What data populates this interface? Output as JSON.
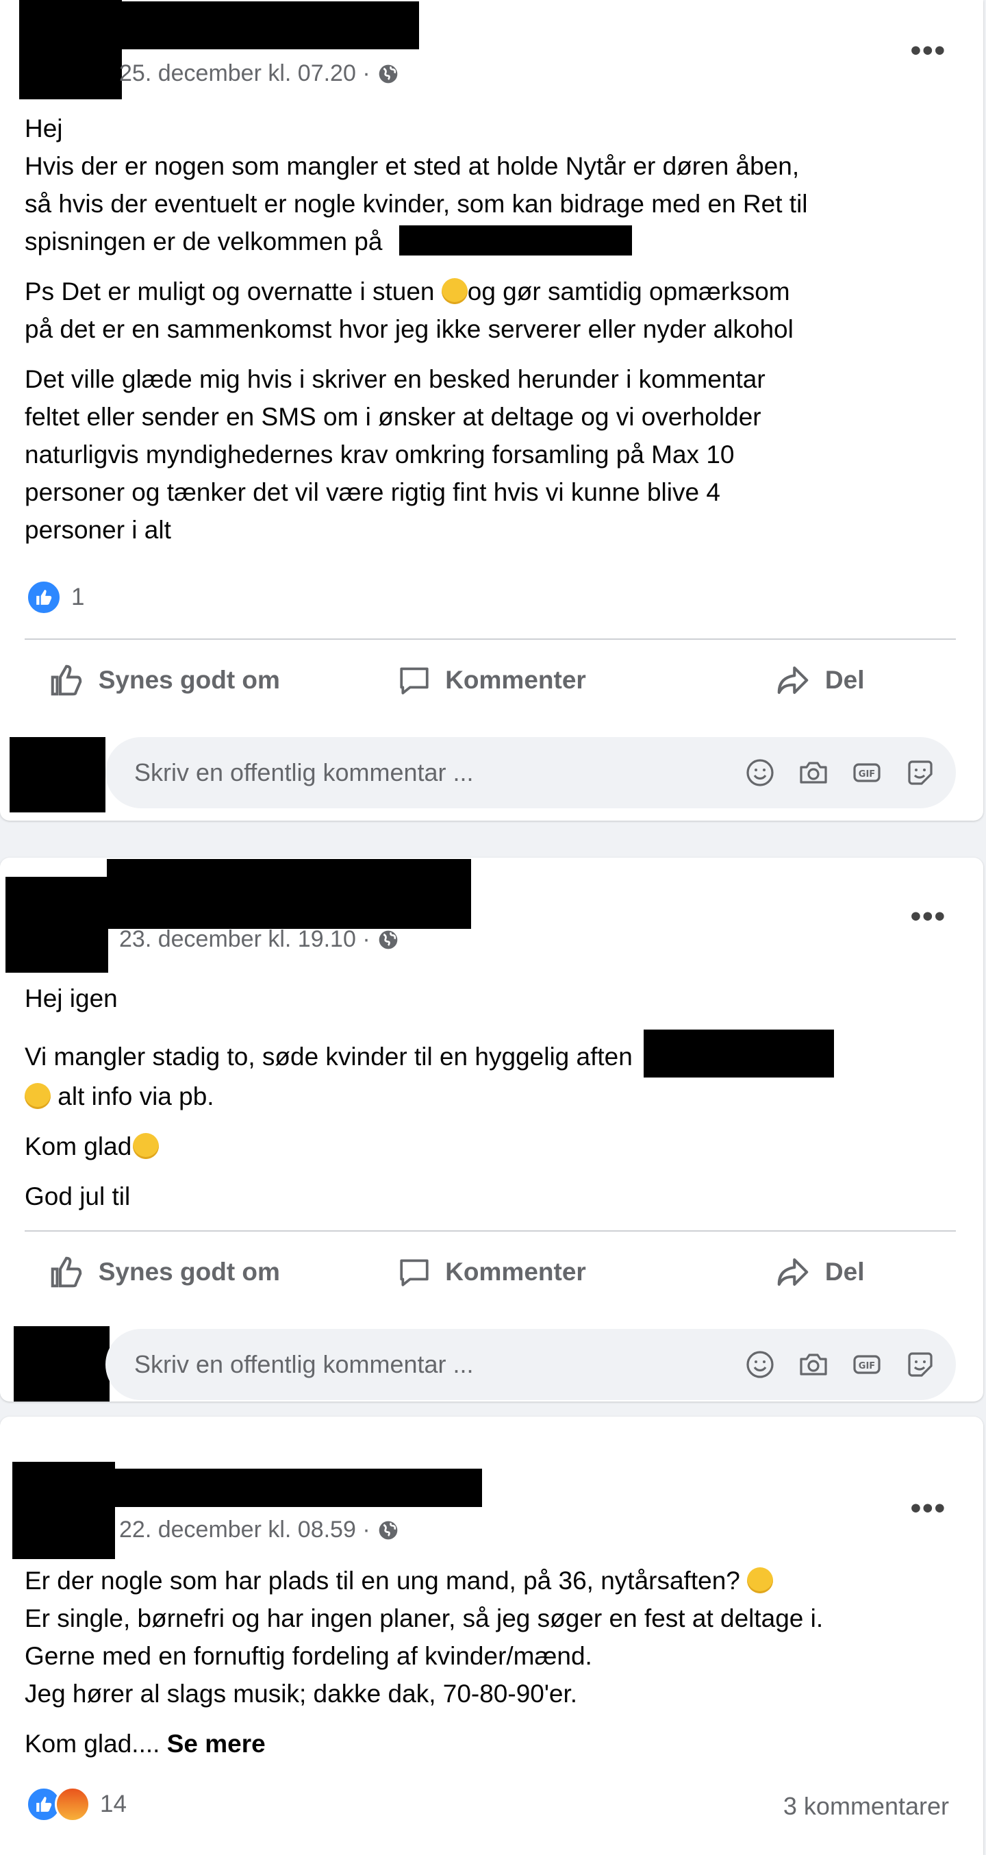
{
  "posts": [
    {
      "timestamp": "25. december kl. 07.20 ·",
      "paragraphs": [
        [
          "Hej",
          "Hvis der er nogen som mangler et sted at holde Nytår er døren åben,",
          "så hvis der eventuelt er nogle kvinder, som kan bidrage med en Ret til",
          "spisningen er de velkommen på"
        ],
        [
          "Ps Det er muligt og overnatte i stuen",
          "og gør samtidig opmærksom",
          "på det er en sammenkomst hvor jeg ikke  serverer eller nyder alkohol"
        ],
        [
          "Det ville glæde mig hvis i skriver en besked herunder i kommentar",
          "feltet eller sender en SMS om i ønsker at deltage og vi overholder",
          "naturligvis myndighedernes krav omkring forsamling på Max 10",
          "personer og tænker det vil være rigtig fint hvis vi kunne blive 4",
          "personer i alt"
        ]
      ],
      "reaction_count": "1"
    },
    {
      "timestamp": "23. december kl. 19.10 ·",
      "lines": [
        "Hej igen",
        "Vi mangler stadig to, søde kvinder til en hyggelig aften",
        "alt info via pb.",
        "Kom glad",
        "God jul til"
      ]
    },
    {
      "timestamp": "22. december kl. 08.59 ·",
      "lines": [
        "Er der nogle som har plads til en ung mand, på 36, nytårsaften?",
        "Er single, børnefri og har ingen planer, så jeg søger en fest at deltage i.",
        "Gerne med en fornuftig fordeling af kvinder/mænd.",
        "Jeg hører al slags musik; dakke dak, 70-80-90'er.",
        "Kom glad....",
        "Se mere"
      ],
      "reaction_count": "14",
      "comments_count": "3 kommentarer"
    }
  ],
  "actions": {
    "like": "Synes godt om",
    "comment": "Kommenter",
    "share": "Del"
  },
  "comment_placeholder": "Skriv en offentlig kommentar ...",
  "icons": {
    "more": "more-options-icon",
    "globe": "globe-icon",
    "like": "thumbs-up-icon",
    "comment": "comment-bubble-icon",
    "share": "share-arrow-icon",
    "emoji": "emoji-icon",
    "camera": "camera-icon",
    "gif": "gif-icon",
    "sticker": "sticker-icon"
  },
  "colors": {
    "like_blue": "#2d88ff",
    "muted_text": "#65676b",
    "background": "#f0f2f5"
  }
}
